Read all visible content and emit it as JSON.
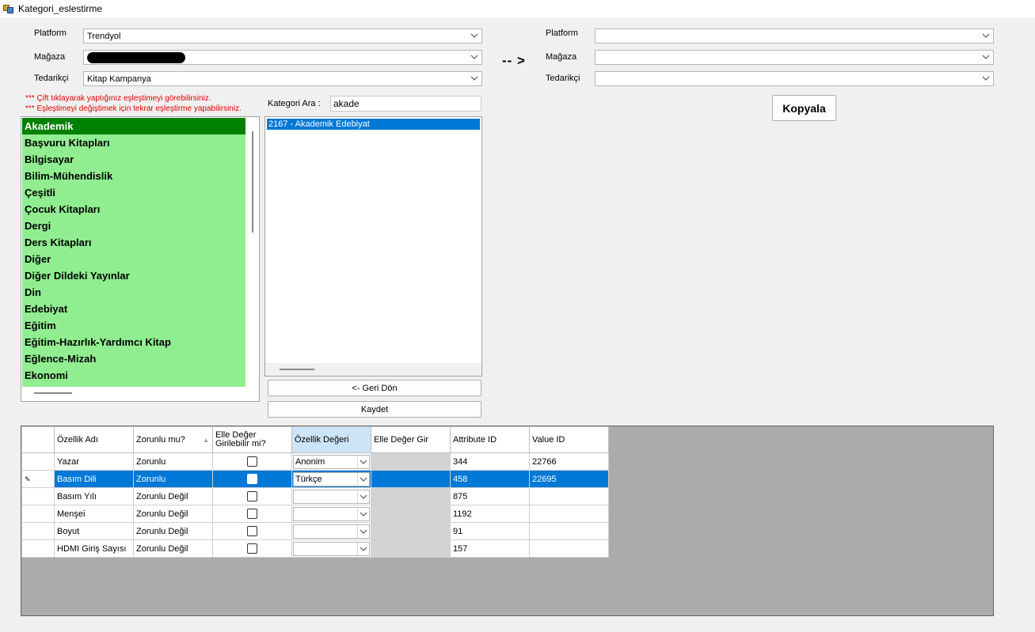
{
  "window": {
    "title": "Kategori_eslestirme"
  },
  "left": {
    "platform_label": "Platform",
    "platform_value": "Trendyol",
    "magaza_label": "Mağaza",
    "tedarikci_label": "Tedarikçi",
    "tedarikci_value": "Kitap Kampanya"
  },
  "arrow": "-- >",
  "right": {
    "platform_label": "Platform",
    "magaza_label": "Mağaza",
    "tedarikci_label": "Tedarikçi",
    "copy_button": "Kopyala"
  },
  "warnings": [
    "*** Çift tıklayarak yaptığınız eşleştimeyi görebilirsiniz.",
    "*** Eşleştimeyi değiştimek için tekrar eşleştirme yapabilirsiniz."
  ],
  "search": {
    "label": "Kategori Ara :",
    "value": "akade"
  },
  "categories": [
    "Akademik",
    "Başvuru Kitapları",
    "Bilgisayar",
    "Bilim-Mühendislik",
    "Çeşitli",
    "Çocuk Kitapları",
    "Dergi",
    "Ders Kitapları",
    "Diğer",
    "Diğer Dildeki Yayınlar",
    "Din",
    "Edebiyat",
    "Eğitim",
    "Eğitim-Hazırlık-Yardımcı Kitap",
    "Eğlence-Mizah",
    "Ekonomi"
  ],
  "results": [
    "2167 - Akademik Edebiyat"
  ],
  "buttons": {
    "back": "<- Geri Dön",
    "save": "Kaydet"
  },
  "grid": {
    "headers": [
      "Özellik Adı",
      "Zorunlu mu?",
      "Elle Değer Girilebilir mi?",
      "Özellik Değeri",
      "Elle Değer Gir",
      "Attribute ID",
      "Value ID"
    ],
    "header_elle_line1": "Elle Değer",
    "header_elle_line2": "Girilebilir mi?",
    "rows": [
      {
        "name": "Yazar",
        "required": "Zorunlu",
        "value": "Anonim",
        "attr_id": "344",
        "value_id": "22766"
      },
      {
        "name": "Basım Dili",
        "required": "Zorunlu",
        "value": "Türkçe",
        "attr_id": "458",
        "value_id": "22695"
      },
      {
        "name": "Basım Yılı",
        "required": "Zorunlu Değil",
        "value": "",
        "attr_id": "875",
        "value_id": ""
      },
      {
        "name": "Menşei",
        "required": "Zorunlu Değil",
        "value": "",
        "attr_id": "1192",
        "value_id": ""
      },
      {
        "name": "Boyut",
        "required": "Zorunlu Değil",
        "value": "",
        "attr_id": "91",
        "value_id": ""
      },
      {
        "name": "HDMI Giriş Sayısı",
        "required": "Zorunlu Değil",
        "value": "",
        "attr_id": "157",
        "value_id": ""
      }
    ],
    "selected_row": 1
  }
}
